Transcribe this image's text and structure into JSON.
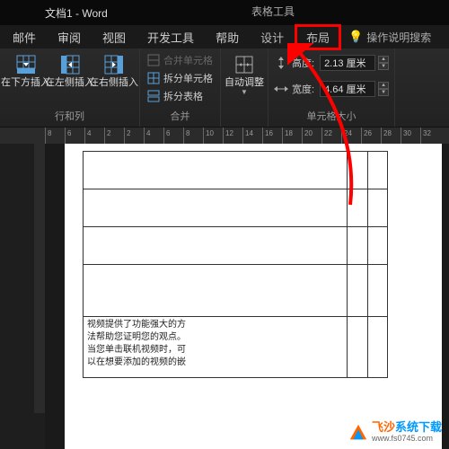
{
  "title": "文档1 - Word",
  "table_tools": "表格工具",
  "tabs": {
    "mail": "邮件",
    "review": "审阅",
    "view": "视图",
    "devtools": "开发工具",
    "help": "帮助",
    "design": "设计",
    "layout": "布局"
  },
  "search_hint": "操作说明搜索",
  "ribbon": {
    "rows_cols": {
      "insert_below": "在下方插入",
      "insert_left": "在左侧插入",
      "insert_right": "在右侧插入",
      "group": "行和列"
    },
    "merge": {
      "merge_cells": "合并单元格",
      "split_cells": "拆分单元格",
      "split_table": "拆分表格",
      "group": "合并"
    },
    "autofit": "自动调整",
    "size": {
      "height_label": "高度:",
      "height_value": "2.13 厘米",
      "width_label": "宽度:",
      "width_value": "4.64 厘米",
      "group": "单元格大小"
    }
  },
  "ruler_numbers": [
    "8",
    "6",
    "4",
    "2",
    "2",
    "4",
    "6",
    "8",
    "10",
    "12",
    "14",
    "16",
    "18",
    "20",
    "22",
    "24",
    "26",
    "28",
    "30",
    "32"
  ],
  "doc_text": {
    "l1": "视频提供了功能强大的方",
    "l2": "法帮助您证明您的观点。",
    "l3": "当您单击联机视频时，可",
    "l4": "以在想要添加的视频的嵌"
  },
  "watermark": {
    "brand1": "飞沙",
    "brand2": "系统下载",
    "url": "www.fs0745.com"
  }
}
